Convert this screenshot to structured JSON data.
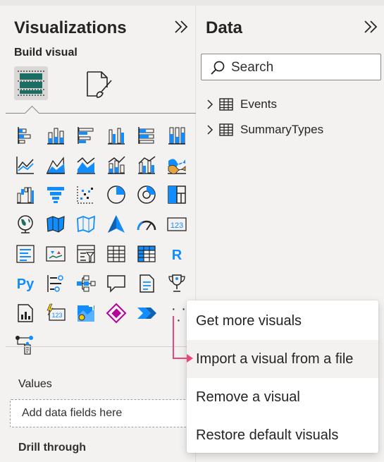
{
  "visualizations_pane": {
    "title": "Visualizations",
    "subheading": "Build visual",
    "tabs": [
      {
        "id": "build",
        "icon": "build-visual-icon",
        "selected": true
      },
      {
        "id": "format",
        "icon": "format-visual-icon",
        "selected": false
      }
    ],
    "gallery": [
      [
        "stacked-bar-chart-icon",
        "stacked-column-chart-icon",
        "clustered-bar-chart-icon",
        "clustered-column-chart-icon",
        "100-stacked-bar-chart-icon",
        "100-stacked-column-chart-icon"
      ],
      [
        "line-chart-icon",
        "area-chart-icon",
        "stacked-area-chart-icon",
        "line-and-stacked-column-chart-icon",
        "line-and-clustered-column-chart-icon",
        "ribbon-chart-icon"
      ],
      [
        "waterfall-chart-icon",
        "funnel-icon",
        "scatter-chart-icon",
        "pie-chart-icon",
        "donut-chart-icon",
        "treemap-icon"
      ],
      [
        "map-icon",
        "filled-map-icon",
        "shape-map-icon",
        "azure-map-icon",
        "gauge-icon",
        "card-icon"
      ],
      [
        "multi-row-card-icon",
        "kpi-icon",
        "slicer-icon",
        "table-icon",
        "matrix-icon",
        "r-visual-icon"
      ],
      [
        "python-visual-icon",
        "key-influencers-icon",
        "decomposition-tree-icon",
        "qa-icon",
        "smart-narrative-icon",
        "metrics-icon"
      ],
      [
        "paginated-report-icon",
        "power-automate-icon",
        "arcgis-map-icon",
        "power-apps-icon",
        "power-automate-flow-icon",
        "more-options-icon"
      ],
      [
        "custom-visual-icon"
      ]
    ],
    "more_options": "· · ·",
    "values_label": "Values",
    "add_fields_placeholder": "Add data fields here",
    "drill_through_label": "Drill through"
  },
  "data_pane": {
    "title": "Data",
    "search_placeholder": "Search",
    "tables": [
      {
        "name": "Events"
      },
      {
        "name": "SummaryTypes"
      }
    ]
  },
  "context_menu": {
    "items": [
      {
        "label": "Get more visuals",
        "highlighted": false
      },
      {
        "label": "Import a visual from a file",
        "highlighted": true
      },
      {
        "label": "Remove a visual",
        "highlighted": false
      },
      {
        "label": "Restore default visuals",
        "highlighted": false
      }
    ]
  },
  "colors": {
    "accent_blue": "#118dff",
    "dark_teal": "#1a6e64",
    "callout_arrow": "#e8467c",
    "pane_bg": "#f3f2f1"
  }
}
